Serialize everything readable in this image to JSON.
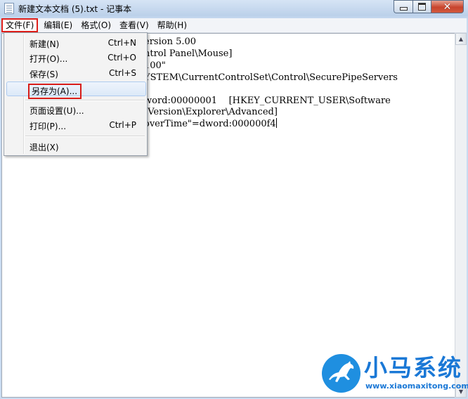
{
  "window": {
    "title": "新建文本文档 (5).txt - 记事本",
    "close_glyph": "✕"
  },
  "menubar": [
    "文件(F)",
    "编辑(E)",
    "格式(O)",
    "查看(V)",
    "帮助(H)"
  ],
  "file_menu": {
    "items": [
      {
        "label": "新建(N)",
        "shortcut": "Ctrl+N"
      },
      {
        "label": "打开(O)...",
        "shortcut": "Ctrl+O"
      },
      {
        "label": "保存(S)",
        "shortcut": "Ctrl+S"
      },
      {
        "label": "另存为(A)...",
        "shortcut": ""
      },
      {
        "label": "页面设置(U)...",
        "shortcut": ""
      },
      {
        "label": "打印(P)...",
        "shortcut": "Ctrl+P"
      },
      {
        "label": "退出(X)",
        "shortcut": ""
      }
    ]
  },
  "editor": {
    "lines": [
      "ersion 5.00",
      "ntrol Panel\\Mouse]",
      "100\"",
      "YSTEM\\CurrentControlSet\\Control\\SecurePipeServers",
      "",
      "word:00000001    [HKEY_CURRENT_USER\\Software",
      "tVersion\\Explorer\\Advanced]",
      "overTime\"=dword:000000f4"
    ]
  },
  "scrollbar": {
    "up_glyph": "▲",
    "down_glyph": "▼"
  },
  "watermark": {
    "title": "小马系统",
    "url": "www.xiaomaxitong.com"
  },
  "icons": [
    "notepad-icon",
    "minimize-icon",
    "maximize-icon",
    "close-icon",
    "horse-logo-icon"
  ],
  "colors": {
    "highlight_box": "#e0201b",
    "watermark": "#1a78d6",
    "close_button": "#c8442d"
  }
}
